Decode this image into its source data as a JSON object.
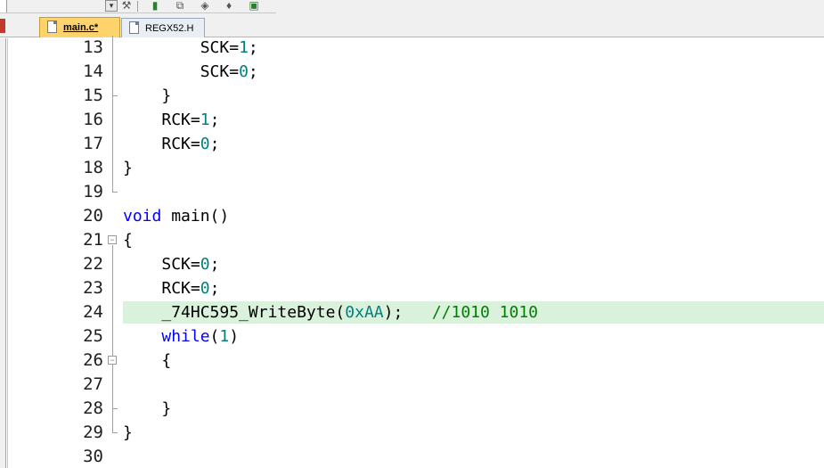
{
  "tabs": [
    {
      "label": "main.c*",
      "active": true
    },
    {
      "label": "REGX52.H",
      "active": false
    }
  ],
  "toolbar": {
    "combo_arrow": "▾",
    "icons": [
      "target-options-icon",
      "build-icon",
      "copy-icon",
      "insert-icon",
      "config-icon",
      "debug-icon"
    ]
  },
  "editor": {
    "highlighted_line": "24",
    "lines": [
      {
        "num": "13",
        "indent": "        ",
        "parts": [
          {
            "t": "SCK=",
            "c": "plain"
          },
          {
            "t": "1",
            "c": "num"
          },
          {
            "t": ";",
            "c": "plain"
          }
        ]
      },
      {
        "num": "14",
        "indent": "        ",
        "parts": [
          {
            "t": "SCK=",
            "c": "plain"
          },
          {
            "t": "0",
            "c": "num"
          },
          {
            "t": ";",
            "c": "plain"
          }
        ]
      },
      {
        "num": "15",
        "indent": "    ",
        "parts": [
          {
            "t": "}",
            "c": "plain"
          }
        ]
      },
      {
        "num": "16",
        "indent": "    ",
        "parts": [
          {
            "t": "RCK=",
            "c": "plain"
          },
          {
            "t": "1",
            "c": "num"
          },
          {
            "t": ";",
            "c": "plain"
          }
        ]
      },
      {
        "num": "17",
        "indent": "    ",
        "parts": [
          {
            "t": "RCK=",
            "c": "plain"
          },
          {
            "t": "0",
            "c": "num"
          },
          {
            "t": ";",
            "c": "plain"
          }
        ]
      },
      {
        "num": "18",
        "indent": "",
        "parts": [
          {
            "t": "}",
            "c": "plain"
          }
        ]
      },
      {
        "num": "19",
        "indent": "",
        "parts": []
      },
      {
        "num": "20",
        "indent": "",
        "parts": [
          {
            "t": "void",
            "c": "kw"
          },
          {
            "t": " main()",
            "c": "plain"
          }
        ]
      },
      {
        "num": "21",
        "indent": "",
        "parts": [
          {
            "t": "{",
            "c": "plain"
          }
        ]
      },
      {
        "num": "22",
        "indent": "    ",
        "parts": [
          {
            "t": "SCK=",
            "c": "plain"
          },
          {
            "t": "0",
            "c": "num"
          },
          {
            "t": ";",
            "c": "plain"
          }
        ]
      },
      {
        "num": "23",
        "indent": "    ",
        "parts": [
          {
            "t": "RCK=",
            "c": "plain"
          },
          {
            "t": "0",
            "c": "num"
          },
          {
            "t": ";",
            "c": "plain"
          }
        ]
      },
      {
        "num": "24",
        "indent": "    ",
        "parts": [
          {
            "t": "_74HC595_WriteByte(",
            "c": "plain"
          },
          {
            "t": "0xAA",
            "c": "num"
          },
          {
            "t": ");   ",
            "c": "plain"
          },
          {
            "t": "//1010 1010",
            "c": "cmt"
          }
        ]
      },
      {
        "num": "25",
        "indent": "    ",
        "parts": [
          {
            "t": "while",
            "c": "kw"
          },
          {
            "t": "(",
            "c": "plain"
          },
          {
            "t": "1",
            "c": "num"
          },
          {
            "t": ")",
            "c": "plain"
          }
        ]
      },
      {
        "num": "26",
        "indent": "    ",
        "parts": [
          {
            "t": "{",
            "c": "plain"
          }
        ]
      },
      {
        "num": "27",
        "indent": "",
        "parts": []
      },
      {
        "num": "28",
        "indent": "    ",
        "parts": [
          {
            "t": "}",
            "c": "plain"
          }
        ]
      },
      {
        "num": "29",
        "indent": "",
        "parts": [
          {
            "t": "}",
            "c": "plain"
          }
        ]
      },
      {
        "num": "30",
        "indent": "",
        "parts": []
      }
    ]
  }
}
